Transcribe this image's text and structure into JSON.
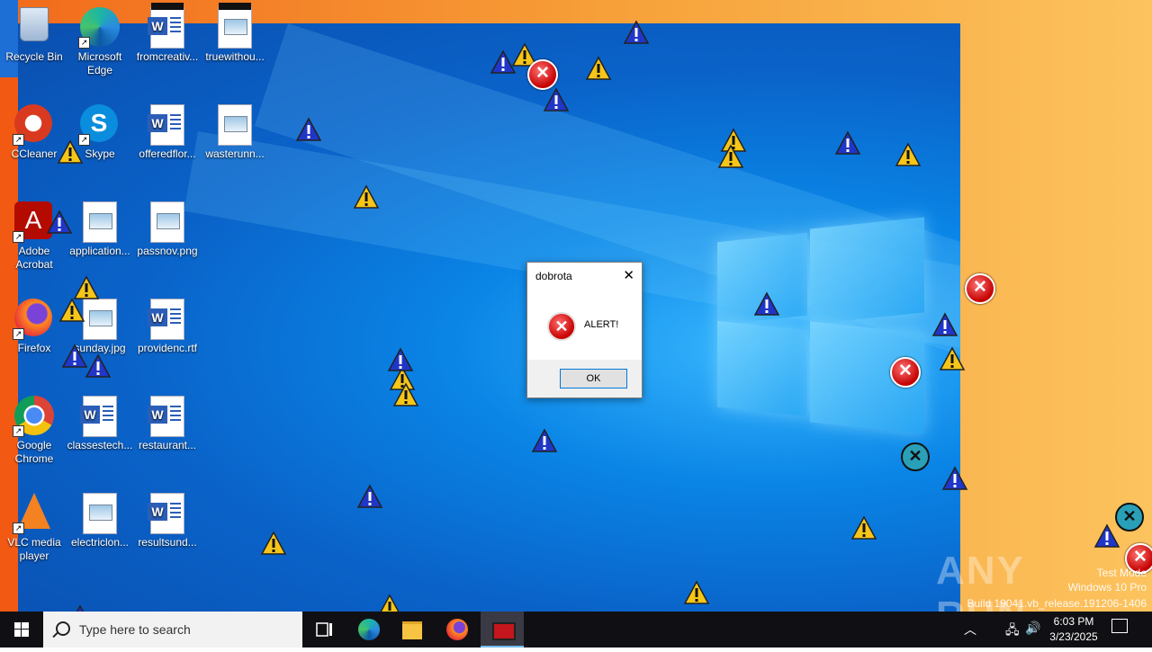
{
  "desktop_icons": [
    {
      "label": "Recycle Bin",
      "icon": "recycle-bin-icon"
    },
    {
      "label": "Microsoft Edge",
      "icon": "edge-icon"
    },
    {
      "label": "fromcreativ...",
      "icon": "word-document-icon"
    },
    {
      "label": "truewithou...",
      "icon": "image-file-icon"
    },
    {
      "label": "CCleaner",
      "icon": "ccleaner-icon"
    },
    {
      "label": "Skype",
      "icon": "skype-icon"
    },
    {
      "label": "offeredflor...",
      "icon": "word-document-icon"
    },
    {
      "label": "wasterunn...",
      "icon": "image-file-icon"
    },
    {
      "label": "Adobe Acrobat",
      "icon": "acrobat-icon"
    },
    {
      "label": "application...",
      "icon": "image-file-icon"
    },
    {
      "label": "passnov.png",
      "icon": "image-file-icon"
    },
    {
      "label": "Firefox",
      "icon": "firefox-icon"
    },
    {
      "label": "sunday.jpg",
      "icon": "image-file-icon"
    },
    {
      "label": "providenc.rtf",
      "icon": "word-document-icon"
    },
    {
      "label": "Google Chrome",
      "icon": "chrome-icon"
    },
    {
      "label": "classestech...",
      "icon": "word-document-icon"
    },
    {
      "label": "restaurant...",
      "icon": "word-document-icon"
    },
    {
      "label": "VLC media player",
      "icon": "vlc-icon"
    },
    {
      "label": "electriclon...",
      "icon": "image-file-icon"
    },
    {
      "label": "resultsund...",
      "icon": "word-document-icon"
    }
  ],
  "dialog": {
    "title": "dobrota",
    "close_label": "✕",
    "icon": "error-icon",
    "message": "ALERT!",
    "ok_label": "OK"
  },
  "taskbar": {
    "search_placeholder": "Type here to search",
    "apps": [
      "task-view-icon",
      "edge-icon",
      "file-explorer-icon",
      "firefox-icon",
      "malware-app-icon"
    ]
  },
  "tray": {
    "time": "6:03 PM",
    "date": "3/23/2025"
  },
  "watermark": {
    "brand": "ANY RUN",
    "line1": "Test Mode",
    "line2": "Windows 10 Pro",
    "line3": "Build 19041.vb_release.191206-1406"
  },
  "colors": {
    "desktop_blue": "#0a63c9",
    "error_red": "#c80000",
    "warning_yellow": "#f5c518",
    "taskbar": "#101014",
    "accent": "#0078d7"
  }
}
